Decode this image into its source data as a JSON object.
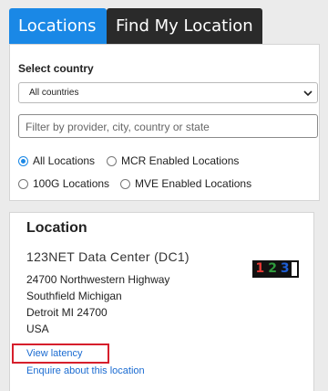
{
  "tabs": [
    {
      "label": "Locations",
      "active": true
    },
    {
      "label": "Find My Location",
      "active": false
    }
  ],
  "filters": {
    "country_label": "Select country",
    "country_selected": "All countries",
    "search_placeholder": "Filter by provider, city, country or state",
    "radio_options": [
      {
        "label": "All Locations",
        "checked": true
      },
      {
        "label": "MCR Enabled Locations",
        "checked": false
      },
      {
        "label": "100G Locations",
        "checked": false
      },
      {
        "label": "MVE Enabled Locations",
        "checked": false
      }
    ]
  },
  "location": {
    "heading": "Location",
    "name": "123NET Data Center (DC1)",
    "address": [
      "24700 Northwestern Highway",
      "Southfield Michigan",
      "Detroit MI 24700",
      "USA"
    ],
    "logo_text": "123",
    "view_latency": "View latency",
    "enquire": "Enquire about this location"
  },
  "colors": {
    "accent": "#1a88e6",
    "tab_dark": "#2a2a2a",
    "link": "#1a6bd1",
    "highlight": "#d61f2c"
  }
}
